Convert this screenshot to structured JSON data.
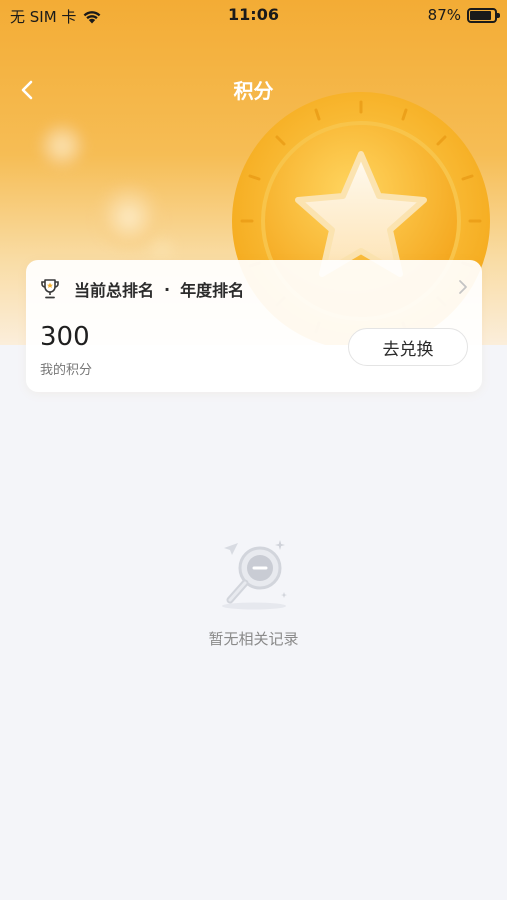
{
  "status_bar": {
    "carrier": "无 SIM 卡",
    "wifi_icon": "wifi-icon",
    "time": "11:06",
    "battery_percent": "87%",
    "battery_level": 0.87
  },
  "nav": {
    "back_icon": "chevron-left-icon",
    "title": "积分"
  },
  "points_card": {
    "trophy_icon": "trophy-icon",
    "rank_label": "当前总排名",
    "rank_separator": "·",
    "rank_period": "年度排名",
    "chevron_icon": "chevron-right-icon",
    "points_value": "300",
    "points_label": "我的积分",
    "redeem_button": "去兑换"
  },
  "empty_state": {
    "icon": "magnifier-empty-icon",
    "text": "暂无相关记录"
  },
  "colors": {
    "header_top": "#f3ac35",
    "header_bottom": "#fbeedb",
    "coin": "#f6b827",
    "page_bg": "#f4f5f9"
  }
}
